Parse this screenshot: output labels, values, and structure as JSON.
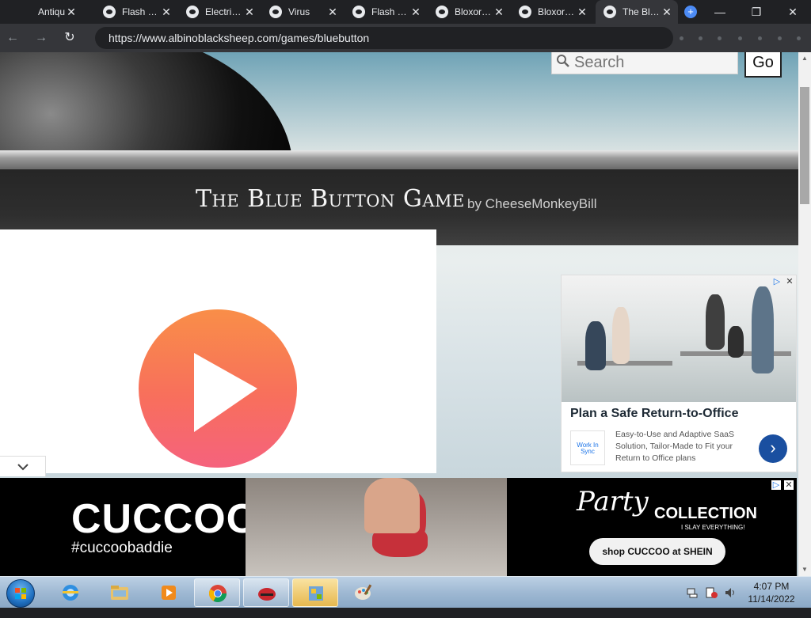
{
  "browser": {
    "tabs": [
      {
        "label": "Antiqu…",
        "close": "✕"
      },
      {
        "label": "Flash …",
        "close": "✕"
      },
      {
        "label": "Electri…",
        "close": "✕"
      },
      {
        "label": "Virus",
        "close": "✕"
      },
      {
        "label": "Flash …",
        "close": "✕"
      },
      {
        "label": "Bloxor…",
        "close": "✕"
      },
      {
        "label": "Bloxor…",
        "close": "✕"
      },
      {
        "label": "The Bl…",
        "close": "✕",
        "active": true
      }
    ],
    "new_tab": "+",
    "window_controls": {
      "minimize": "—",
      "restore": "❐",
      "close": "✕"
    },
    "nav": {
      "back": "←",
      "forward": "→",
      "reload": "↻"
    },
    "url": "https://www.albinoblacksheep.com/games/bluebutton"
  },
  "page": {
    "search": {
      "placeholder": "Search",
      "icon": "search-icon",
      "go_label": "Go"
    },
    "game_title": "The Blue Button Game",
    "byline": "by CheeseMonkeyBill",
    "play_icon": "play-icon",
    "collapse_icon": "chevron-down-icon",
    "side_ad": {
      "headline": "Plan a Safe Return-to-Office",
      "logo_text": "Work In Sync",
      "description": "Easy-to-Use and Adaptive SaaS Solution, Tailor-Made to Fit your Return to Office plans",
      "arrow": "›"
    },
    "bottom_ad": {
      "brand": "CUCCOO",
      "hashtag": "#cuccoobaddie",
      "party": "Party",
      "collection": "COLLECTION",
      "tagline": "I SLAY EVERYTHING!",
      "cta": "shop CUCCOO at SHEIN"
    },
    "ad_choices": {
      "info": "▷",
      "close": "✕"
    }
  },
  "scrollbar": {
    "up": "▲",
    "down": "▼",
    "position": 0.08
  },
  "taskbar": {
    "clock_time": "4:07 PM",
    "clock_date": "11/14/2022",
    "items": [
      "internet-explorer-icon",
      "file-explorer-icon",
      "media-player-icon",
      "chrome-icon",
      "game-icon",
      "control-panel-icon",
      "paint-icon"
    ]
  },
  "colors": {
    "play_top": "#f98e48",
    "play_bottom": "#f5627d",
    "ad_arrow": "#1a4fa0",
    "chrome_dark": "#202124"
  }
}
